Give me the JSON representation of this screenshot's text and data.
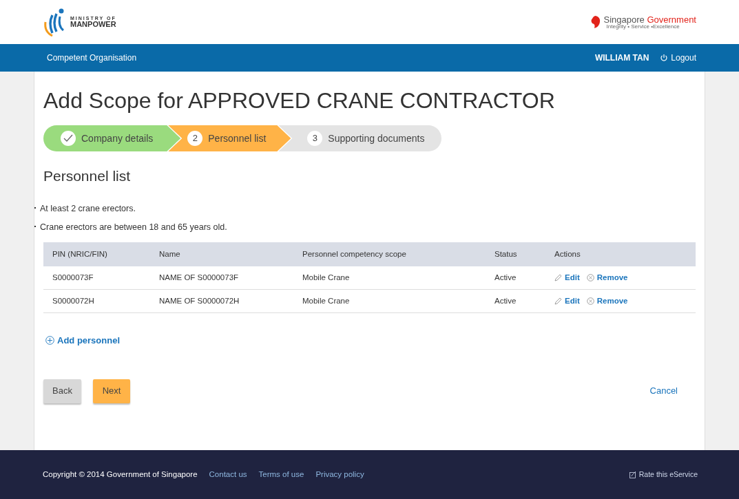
{
  "header": {
    "ministry_logo": [
      "MINISTRY OF",
      "MANPOWER"
    ],
    "gov_logo": {
      "name": "Singapore",
      "name_highlight": "Government",
      "tagline": "Integrity • Service •Excellence"
    }
  },
  "navbar": {
    "title": "Competent Organisation",
    "user": "WILLIAM TAN",
    "logout": "Logout"
  },
  "page_title": "Add Scope for APPROVED CRANE CONTRACTOR",
  "steps": [
    {
      "label": "Company details",
      "completed": true,
      "selected": false
    },
    {
      "label": "Personnel list",
      "marker": "2",
      "completed": false,
      "selected": true
    },
    {
      "label": "Supporting documents",
      "marker": "3",
      "completed": false,
      "selected": false
    }
  ],
  "section_title": "Personnel list",
  "requirements": [
    "At least 2 crane erectors.",
    "Crane erectors are between 18 and 65 years old."
  ],
  "table": {
    "columns": [
      "PIN (NRIC/FIN)",
      "Name",
      "Personnel competency scope",
      "Status",
      "Actions"
    ],
    "rows": [
      {
        "pin": "S0000073F",
        "name": "NAME OF S0000073F",
        "scope": "Mobile Crane",
        "status": "Active",
        "edit": "Edit",
        "remove": "Remove"
      },
      {
        "pin": "S0000072H",
        "name": "NAME OF S0000072H",
        "scope": "Mobile Crane",
        "status": "Active",
        "edit": "Edit",
        "remove": "Remove"
      }
    ]
  },
  "add_personnel": "Add personnel",
  "buttons": {
    "back": "Back",
    "next": "Next",
    "cancel": "Cancel"
  },
  "footer": {
    "copyright": "Copyright © 2014 Government of Singapore",
    "links": [
      "Contact us",
      "Terms of use",
      "Privacy policy"
    ],
    "rate": "Rate this eService"
  }
}
